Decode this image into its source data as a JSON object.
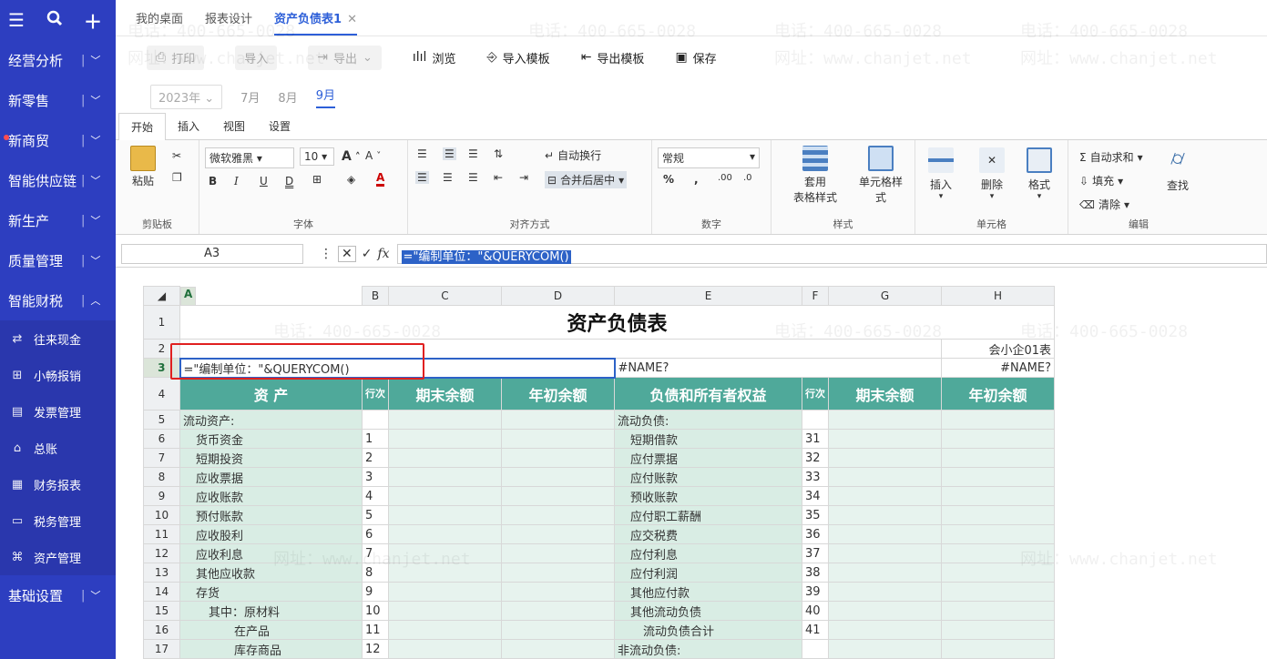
{
  "sidebar": {
    "top_icons": [
      "menu-icon",
      "search-icon",
      "plus-icon"
    ],
    "items": [
      {
        "label": "经营分析",
        "expanded": false
      },
      {
        "label": "新零售",
        "expanded": false
      },
      {
        "label": "新商贸",
        "expanded": false,
        "dot": true
      },
      {
        "label": "智能供应链",
        "expanded": false
      },
      {
        "label": "新生产",
        "expanded": false
      },
      {
        "label": "质量管理",
        "expanded": false
      },
      {
        "label": "智能财税",
        "expanded": true
      }
    ],
    "sub_items": [
      {
        "label": "往来现金",
        "icon": "exchange-icon"
      },
      {
        "label": "小畅报销",
        "icon": "expense-icon"
      },
      {
        "label": "发票管理",
        "icon": "invoice-icon"
      },
      {
        "label": "总账",
        "icon": "ledger-icon"
      },
      {
        "label": "财务报表",
        "icon": "report-icon"
      },
      {
        "label": "税务管理",
        "icon": "tax-icon"
      },
      {
        "label": "资产管理",
        "icon": "bank-icon"
      }
    ],
    "bottom_item": {
      "label": "基础设置"
    }
  },
  "tabs": [
    {
      "label": "我的桌面",
      "active": false
    },
    {
      "label": "报表设计",
      "active": false
    },
    {
      "label": "资产负债表1",
      "active": true
    }
  ],
  "toolbar": {
    "print": "打印",
    "import": "导入",
    "export": "导出",
    "browse": "浏览",
    "import_template": "导入模板",
    "export_template": "导出模板",
    "save": "保存"
  },
  "period": {
    "year": "2023年",
    "months": [
      "7月",
      "8月",
      "9月"
    ],
    "active_month": "9月"
  },
  "ribbon_tabs": [
    "开始",
    "插入",
    "视图",
    "设置"
  ],
  "ribbon": {
    "paste": "粘贴",
    "clipboard": "剪贴板",
    "font_name": "微软雅黑",
    "font_size": "10",
    "font_group": "字体",
    "wrap": "自动换行",
    "merge": "合并后居中",
    "align_group": "对齐方式",
    "number_format": "常规",
    "number_group": "数字",
    "table_style": "套用\n表格样式",
    "table_style_l1": "套用",
    "table_style_l2": "表格样式",
    "cell_style_l1": "单元格样",
    "cell_style_l2": "式",
    "style_group": "样式",
    "insert": "插入",
    "delete": "删除",
    "format": "格式",
    "cells_group": "单元格",
    "autosum": "自动求和",
    "fill": "填充",
    "clear": "清除",
    "find": "查找",
    "edit_group": "编辑"
  },
  "formula_bar": {
    "cell_ref": "A3",
    "formula": "=\"编制单位：\"&QUERYCOM()"
  },
  "sheet": {
    "columns": [
      "A",
      "B",
      "C",
      "D",
      "E",
      "F",
      "G",
      "H"
    ],
    "title": "资产负债表",
    "form_no": "会小企01表",
    "a3": "=\"编制单位：\"&QUERYCOM()",
    "e3": "#NAME?",
    "h3": "#NAME?",
    "header": {
      "assets": "资    产",
      "line": "行次",
      "end_bal": "期末余额",
      "begin_bal": "年初余额",
      "liab": "负债和所有者权益",
      "line2": "行次",
      "end_bal2": "期末余额",
      "begin_bal2": "年初余额"
    },
    "rows": [
      {
        "n": "5",
        "a": "流动资产:",
        "b": "",
        "e": "流动负债:",
        "f": "",
        "ai": 0,
        "ei": 0
      },
      {
        "n": "6",
        "a": "货币资金",
        "b": "1",
        "e": "短期借款",
        "f": "31",
        "ai": 1,
        "ei": 1
      },
      {
        "n": "7",
        "a": "短期投资",
        "b": "2",
        "e": "应付票据",
        "f": "32",
        "ai": 1,
        "ei": 1
      },
      {
        "n": "8",
        "a": "应收票据",
        "b": "3",
        "e": "应付账款",
        "f": "33",
        "ai": 1,
        "ei": 1
      },
      {
        "n": "9",
        "a": "应收账款",
        "b": "4",
        "e": "预收账款",
        "f": "34",
        "ai": 1,
        "ei": 1
      },
      {
        "n": "10",
        "a": "预付账款",
        "b": "5",
        "e": "应付职工薪酬",
        "f": "35",
        "ai": 1,
        "ei": 1
      },
      {
        "n": "11",
        "a": "应收股利",
        "b": "6",
        "e": "应交税费",
        "f": "36",
        "ai": 1,
        "ei": 1
      },
      {
        "n": "12",
        "a": "应收利息",
        "b": "7",
        "e": "应付利息",
        "f": "37",
        "ai": 1,
        "ei": 1
      },
      {
        "n": "13",
        "a": "其他应收款",
        "b": "8",
        "e": "应付利润",
        "f": "38",
        "ai": 1,
        "ei": 1
      },
      {
        "n": "14",
        "a": "存货",
        "b": "9",
        "e": "其他应付款",
        "f": "39",
        "ai": 1,
        "ei": 1
      },
      {
        "n": "15",
        "a": "其中：原材料",
        "b": "10",
        "e": "其他流动负债",
        "f": "40",
        "ai": 2,
        "ei": 1
      },
      {
        "n": "16",
        "a": "在产品",
        "b": "11",
        "e": "流动负债合计",
        "f": "41",
        "ai": 4,
        "ei": 2
      },
      {
        "n": "17",
        "a": "库存商品",
        "b": "12",
        "e": "非流动负债:",
        "f": "",
        "ai": 4,
        "ei": 0
      }
    ]
  },
  "watermarks": {
    "phone": "电话：400-665-0028",
    "site": "网址：www.chanjet.net"
  },
  "colors": {
    "sidebar": "#2d3ec0",
    "header_green": "#4fa99a",
    "cell_green": "#d9ede4",
    "accent": "#2d5fd8",
    "highlight_box": "#e02020"
  }
}
